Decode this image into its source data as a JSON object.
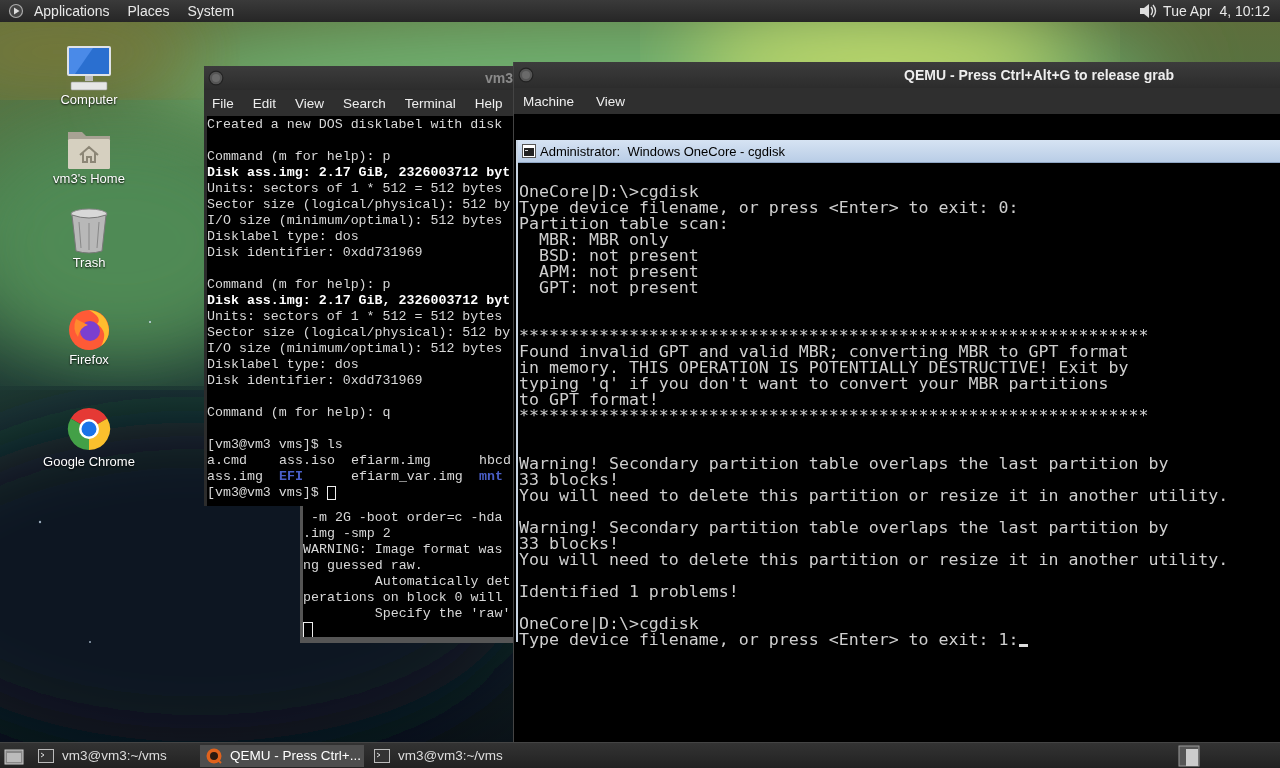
{
  "top_panel": {
    "menus": [
      {
        "label": "Applications"
      },
      {
        "label": "Places"
      },
      {
        "label": "System"
      }
    ],
    "clock": "Tue Apr  4, 10:12"
  },
  "desktop_icons": [
    {
      "label": "Computer",
      "kind": "computer"
    },
    {
      "label": "vm3's Home",
      "kind": "home"
    },
    {
      "label": "Trash",
      "kind": "trash"
    },
    {
      "label": "Firefox",
      "kind": "firefox"
    },
    {
      "label": "Google Chrome",
      "kind": "chrome"
    }
  ],
  "terminal": {
    "title": "vm3",
    "menus": [
      "File",
      "Edit",
      "View",
      "Search",
      "Terminal",
      "Help"
    ],
    "lines": [
      {
        "kind": "text",
        "text": "Created a new DOS disklabel with disk"
      },
      {
        "kind": "blank"
      },
      {
        "kind": "text",
        "text": "Command (m for help): p"
      },
      {
        "kind": "bold",
        "text": "Disk ass.img: 2.17 GiB, 2326003712 byt"
      },
      {
        "kind": "text",
        "text": "Units: sectors of 1 * 512 = 512 bytes"
      },
      {
        "kind": "text",
        "text": "Sector size (logical/physical): 512 by"
      },
      {
        "kind": "text",
        "text": "I/O size (minimum/optimal): 512 bytes"
      },
      {
        "kind": "text",
        "text": "Disklabel type: dos"
      },
      {
        "kind": "text",
        "text": "Disk identifier: 0xdd731969"
      },
      {
        "kind": "blank"
      },
      {
        "kind": "text",
        "text": "Command (m for help): p"
      },
      {
        "kind": "bold",
        "text": "Disk ass.img: 2.17 GiB, 2326003712 byt"
      },
      {
        "kind": "text",
        "text": "Units: sectors of 1 * 512 = 512 bytes"
      },
      {
        "kind": "text",
        "text": "Sector size (logical/physical): 512 by"
      },
      {
        "kind": "text",
        "text": "I/O size (minimum/optimal): 512 bytes"
      },
      {
        "kind": "text",
        "text": "Disklabel type: dos"
      },
      {
        "kind": "text",
        "text": "Disk identifier: 0xdd731969"
      },
      {
        "kind": "blank"
      },
      {
        "kind": "text",
        "text": "Command (m for help): q"
      },
      {
        "kind": "blank"
      },
      {
        "kind": "text",
        "text": "[vm3@vm3 vms]$ ls"
      },
      {
        "kind": "listing",
        "entries": [
          {
            "name": "a.cmd",
            "kind": "file"
          },
          {
            "name": "ass.iso",
            "kind": "file"
          },
          {
            "name": "efiarm.img",
            "kind": "file"
          },
          {
            "name": "hbcd",
            "kind": "file"
          }
        ]
      },
      {
        "kind": "listing",
        "entries": [
          {
            "name": "ass.img",
            "kind": "file"
          },
          {
            "name": "EFI",
            "kind": "dir"
          },
          {
            "name": "efiarm_var.img",
            "kind": "file"
          },
          {
            "name": "mnt",
            "kind": "dir"
          }
        ]
      },
      {
        "kind": "prompt",
        "text": "[vm3@vm3 vms]$",
        "cursor": true
      }
    ]
  },
  "terminal_behind": {
    "lines": [
      {
        "kind": "text",
        "text": " -m 2G -boot order=c -hda"
      },
      {
        "kind": "text",
        "text": ".img -smp 2"
      },
      {
        "kind": "text",
        "text": "WARNING: Image format was"
      },
      {
        "kind": "text",
        "text": "ng guessed raw."
      },
      {
        "kind": "text",
        "text": "         Automatically det"
      },
      {
        "kind": "text",
        "text": "perations on block 0 will"
      },
      {
        "kind": "text",
        "text": "         Specify the 'raw'"
      },
      {
        "kind": "prompt",
        "cursor": true
      }
    ]
  },
  "qemu": {
    "title": "QEMU - Press Ctrl+Alt+G to release grab",
    "menus": [
      "Machine",
      "View"
    ],
    "console": {
      "title": "Administrator:  Windows OneCore - cgdisk",
      "lines": [
        {
          "kind": "blank"
        },
        {
          "kind": "text",
          "text": "OneCore|D:\\>cgdisk"
        },
        {
          "kind": "text",
          "text": "Type device filename, or press <Enter> to exit: 0:"
        },
        {
          "kind": "text",
          "text": "Partition table scan:"
        },
        {
          "kind": "text",
          "text": "  MBR: MBR only"
        },
        {
          "kind": "text",
          "text": "  BSD: not present"
        },
        {
          "kind": "text",
          "text": "  APM: not present"
        },
        {
          "kind": "text",
          "text": "  GPT: not present"
        },
        {
          "kind": "blank"
        },
        {
          "kind": "blank"
        },
        {
          "kind": "text",
          "text": "***************************************************************"
        },
        {
          "kind": "text",
          "text": "Found invalid GPT and valid MBR; converting MBR to GPT format"
        },
        {
          "kind": "text",
          "text": "in memory. THIS OPERATION IS POTENTIALLY DESTRUCTIVE! Exit by"
        },
        {
          "kind": "text",
          "text": "typing 'q' if you don't want to convert your MBR partitions"
        },
        {
          "kind": "text",
          "text": "to GPT format!"
        },
        {
          "kind": "text",
          "text": "***************************************************************"
        },
        {
          "kind": "blank"
        },
        {
          "kind": "blank"
        },
        {
          "kind": "text",
          "text": "Warning! Secondary partition table overlaps the last partition by"
        },
        {
          "kind": "text",
          "text": "33 blocks!"
        },
        {
          "kind": "text",
          "text": "You will need to delete this partition or resize it in another utility."
        },
        {
          "kind": "blank"
        },
        {
          "kind": "text",
          "text": "Warning! Secondary partition table overlaps the last partition by"
        },
        {
          "kind": "text",
          "text": "33 blocks!"
        },
        {
          "kind": "text",
          "text": "You will need to delete this partition or resize it in another utility."
        },
        {
          "kind": "blank"
        },
        {
          "kind": "text",
          "text": "Identified 1 problems!"
        },
        {
          "kind": "blank"
        },
        {
          "kind": "text",
          "text": "OneCore|D:\\>cgdisk"
        },
        {
          "kind": "prompt",
          "text": "Type device filename, or press <Enter> to exit: 1:",
          "cursor": true
        }
      ]
    }
  },
  "taskbar": {
    "tasks": [
      {
        "label": "vm3@vm3:~/vms",
        "kind": "terminal",
        "selected": false
      },
      {
        "label": "QEMU - Press Ctrl+...",
        "kind": "qemu",
        "selected": true
      },
      {
        "label": "vm3@vm3:~/vms",
        "kind": "terminal",
        "selected": false
      }
    ]
  }
}
